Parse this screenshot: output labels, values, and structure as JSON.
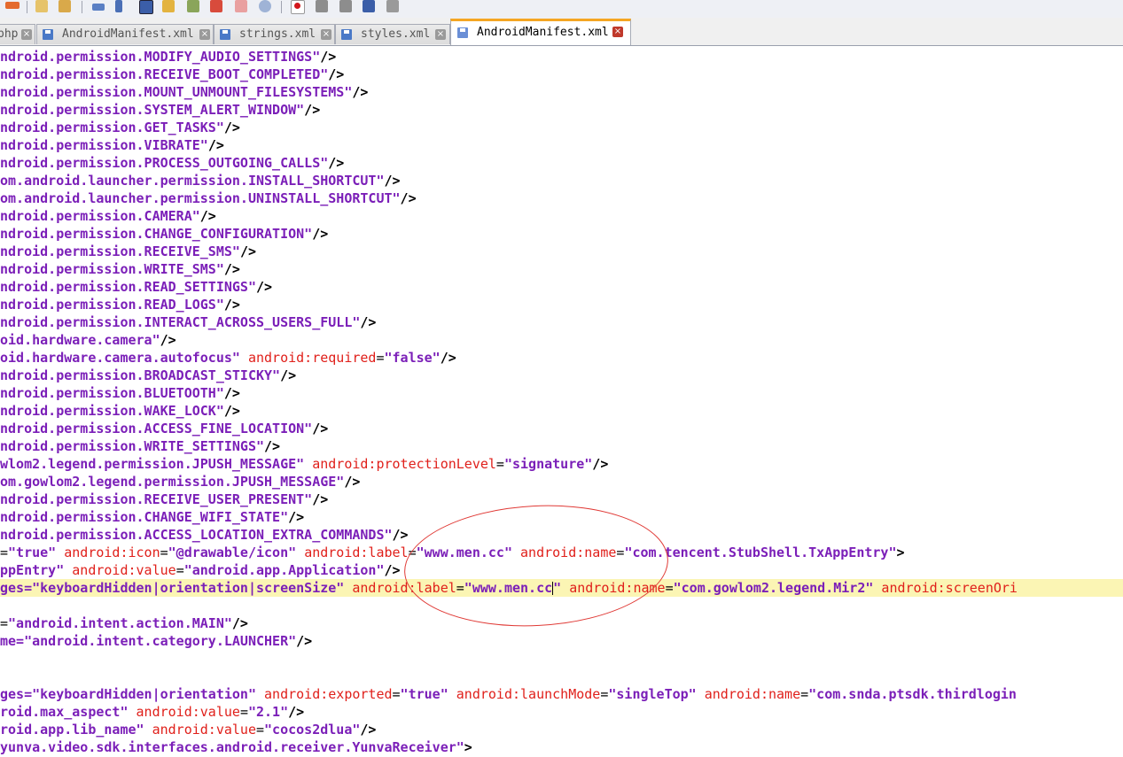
{
  "tabs": [
    {
      "label": "php",
      "active": false
    },
    {
      "label": "AndroidManifest.xml",
      "active": false
    },
    {
      "label": "strings.xml",
      "active": false
    },
    {
      "label": "styles.xml",
      "active": false
    },
    {
      "label": "AndroidManifest.xml",
      "active": true
    }
  ],
  "toolbar_icons": [
    "pencil-icon",
    "copy-icon",
    "paste-icon",
    "wrap-icon",
    "paragraph-icon",
    "indent-icon",
    "folder-icon",
    "bookmark-icon",
    "pen-icon",
    "image-icon",
    "eye-icon",
    "record-icon",
    "stop-icon",
    "play-icon",
    "fast-forward-icon",
    "save-macro-icon"
  ],
  "lines": [
    [
      [
        "s",
        "ndroid.permission.MODIFY_AUDIO_SETTINGS\""
      ],
      [
        "p",
        "/>"
      ]
    ],
    [
      [
        "s",
        "ndroid.permission.RECEIVE_BOOT_COMPLETED\""
      ],
      [
        "p",
        "/>"
      ]
    ],
    [
      [
        "s",
        "ndroid.permission.MOUNT_UNMOUNT_FILESYSTEMS\""
      ],
      [
        "p",
        "/>"
      ]
    ],
    [
      [
        "s",
        "ndroid.permission.SYSTEM_ALERT_WINDOW\""
      ],
      [
        "p",
        "/>"
      ]
    ],
    [
      [
        "s",
        "ndroid.permission.GET_TASKS\""
      ],
      [
        "p",
        "/>"
      ]
    ],
    [
      [
        "s",
        "ndroid.permission.VIBRATE\""
      ],
      [
        "p",
        "/>"
      ]
    ],
    [
      [
        "s",
        "ndroid.permission.PROCESS_OUTGOING_CALLS\""
      ],
      [
        "p",
        "/>"
      ]
    ],
    [
      [
        "s",
        "om.android.launcher.permission.INSTALL_SHORTCUT\""
      ],
      [
        "p",
        "/>"
      ]
    ],
    [
      [
        "s",
        "om.android.launcher.permission.UNINSTALL_SHORTCUT\""
      ],
      [
        "p",
        "/>"
      ]
    ],
    [
      [
        "s",
        "ndroid.permission.CAMERA\""
      ],
      [
        "p",
        "/>"
      ]
    ],
    [
      [
        "s",
        "ndroid.permission.CHANGE_CONFIGURATION\""
      ],
      [
        "p",
        "/>"
      ]
    ],
    [
      [
        "s",
        "ndroid.permission.RECEIVE_SMS\""
      ],
      [
        "p",
        "/>"
      ]
    ],
    [
      [
        "s",
        "ndroid.permission.WRITE_SMS\""
      ],
      [
        "p",
        "/>"
      ]
    ],
    [
      [
        "s",
        "ndroid.permission.READ_SETTINGS\""
      ],
      [
        "p",
        "/>"
      ]
    ],
    [
      [
        "s",
        "ndroid.permission.READ_LOGS\""
      ],
      [
        "p",
        "/>"
      ]
    ],
    [
      [
        "s",
        "ndroid.permission.INTERACT_ACROSS_USERS_FULL\""
      ],
      [
        "p",
        "/>"
      ]
    ],
    [
      [
        "s",
        "oid.hardware.camera\""
      ],
      [
        "p",
        "/>"
      ]
    ],
    [
      [
        "s",
        "oid.hardware.camera.autofocus\" "
      ],
      [
        "a",
        "android:required"
      ],
      [
        "e",
        "="
      ],
      [
        "s",
        "\"false\""
      ],
      [
        "p",
        "/>"
      ]
    ],
    [
      [
        "s",
        "ndroid.permission.BROADCAST_STICKY\""
      ],
      [
        "p",
        "/>"
      ]
    ],
    [
      [
        "s",
        "ndroid.permission.BLUETOOTH\""
      ],
      [
        "p",
        "/>"
      ]
    ],
    [
      [
        "s",
        "ndroid.permission.WAKE_LOCK\""
      ],
      [
        "p",
        "/>"
      ]
    ],
    [
      [
        "s",
        "ndroid.permission.ACCESS_FINE_LOCATION\""
      ],
      [
        "p",
        "/>"
      ]
    ],
    [
      [
        "s",
        "ndroid.permission.WRITE_SETTINGS\""
      ],
      [
        "p",
        "/>"
      ]
    ],
    [
      [
        "s",
        "wlom2.legend.permission.JPUSH_MESSAGE\" "
      ],
      [
        "a",
        "android:protectionLevel"
      ],
      [
        "e",
        "="
      ],
      [
        "s",
        "\"signature\""
      ],
      [
        "p",
        "/>"
      ]
    ],
    [
      [
        "s",
        "om.gowlom2.legend.permission.JPUSH_MESSAGE\""
      ],
      [
        "p",
        "/>"
      ]
    ],
    [
      [
        "s",
        "ndroid.permission.RECEIVE_USER_PRESENT\""
      ],
      [
        "p",
        "/>"
      ]
    ],
    [
      [
        "s",
        "ndroid.permission.CHANGE_WIFI_STATE\""
      ],
      [
        "p",
        "/>"
      ]
    ],
    [
      [
        "s",
        "ndroid.permission.ACCESS_LOCATION_EXTRA_COMMANDS\""
      ],
      [
        "p",
        "/>"
      ]
    ],
    [
      [
        "e",
        "="
      ],
      [
        "s",
        "\"true\" "
      ],
      [
        "a",
        "android:icon"
      ],
      [
        "e",
        "="
      ],
      [
        "s",
        "\"@drawable/icon\" "
      ],
      [
        "a",
        "android:label"
      ],
      [
        "e",
        "="
      ],
      [
        "s",
        "\"www.men.cc\" "
      ],
      [
        "a",
        "android:name"
      ],
      [
        "e",
        "="
      ],
      [
        "s",
        "\"com.tencent.StubShell.TxAppEntry\""
      ],
      [
        "p",
        ">"
      ]
    ],
    [
      [
        "s",
        "ppEntry\" "
      ],
      [
        "a",
        "android:value"
      ],
      [
        "e",
        "="
      ],
      [
        "s",
        "\"android.app.Application\""
      ],
      [
        "p",
        "/>"
      ]
    ],
    [
      [
        "s",
        "ges=\"keyboardHidden|orientation|screenSize\" "
      ],
      [
        "a",
        "android:label"
      ],
      [
        "e",
        "="
      ],
      [
        "s",
        "\"www.men.cc"
      ],
      [
        "c",
        ""
      ],
      [
        "s",
        "\" "
      ],
      [
        "a",
        "android:name"
      ],
      [
        "e",
        "="
      ],
      [
        "s",
        "\"com.gowlom2.legend.Mir2\" "
      ],
      [
        "a",
        "android:screenOri"
      ]
    ],
    [],
    [
      [
        "e",
        "="
      ],
      [
        "s",
        "\"android.intent.action.MAIN\""
      ],
      [
        "p",
        "/>"
      ]
    ],
    [
      [
        "s",
        "me=\"android.intent.category.LAUNCHER\""
      ],
      [
        "p",
        "/>"
      ]
    ],
    [],
    [],
    [
      [
        "s",
        "ges=\"keyboardHidden|orientation\" "
      ],
      [
        "a",
        "android:exported"
      ],
      [
        "e",
        "="
      ],
      [
        "s",
        "\"true\" "
      ],
      [
        "a",
        "android:launchMode"
      ],
      [
        "e",
        "="
      ],
      [
        "s",
        "\"singleTop\" "
      ],
      [
        "a",
        "android:name"
      ],
      [
        "e",
        "="
      ],
      [
        "s",
        "\"com.snda.ptsdk.thirdlogin"
      ]
    ],
    [
      [
        "s",
        "roid.max_aspect\" "
      ],
      [
        "a",
        "android:value"
      ],
      [
        "e",
        "="
      ],
      [
        "s",
        "\"2.1\""
      ],
      [
        "p",
        "/>"
      ]
    ],
    [
      [
        "s",
        "roid.app.lib_name\" "
      ],
      [
        "a",
        "android:value"
      ],
      [
        "e",
        "="
      ],
      [
        "s",
        "\"cocos2dlua\""
      ],
      [
        "p",
        "/>"
      ]
    ],
    [
      [
        "s",
        "yunva.video.sdk.interfaces.android.receiver.YunvaReceiver\""
      ],
      [
        "p",
        ">"
      ]
    ]
  ],
  "current_line": 30,
  "colors": {
    "string": "#7b1fb8",
    "attribute": "#e0201b",
    "current_line_bg": "#fbf5b4",
    "active_tab_accent": "#f5a623"
  }
}
